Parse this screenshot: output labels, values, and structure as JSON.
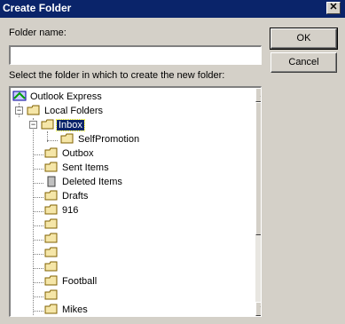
{
  "window": {
    "title": "Create Folder",
    "close_glyph": "✕"
  },
  "form": {
    "folder_name_label": "Folder name:",
    "folder_name_value": "",
    "select_label": "Select the folder in which to create the new folder:"
  },
  "buttons": {
    "ok": "OK",
    "cancel": "Cancel"
  },
  "tree": {
    "root": "Outlook Express",
    "local_folders": "Local Folders",
    "inbox": "Inbox",
    "selfpromotion": "SelfPromotion",
    "outbox": "Outbox",
    "sent_items": "Sent Items",
    "deleted_items": "Deleted Items",
    "drafts": "Drafts",
    "f916": "916",
    "blank1": "",
    "blank2": "",
    "blank3": "",
    "blank4": "",
    "football": "Football",
    "blank5": "",
    "mikes": "Mikes",
    "expand_minus": "−"
  },
  "scroll": {
    "up_glyph": "▲",
    "down_glyph": "▼"
  }
}
